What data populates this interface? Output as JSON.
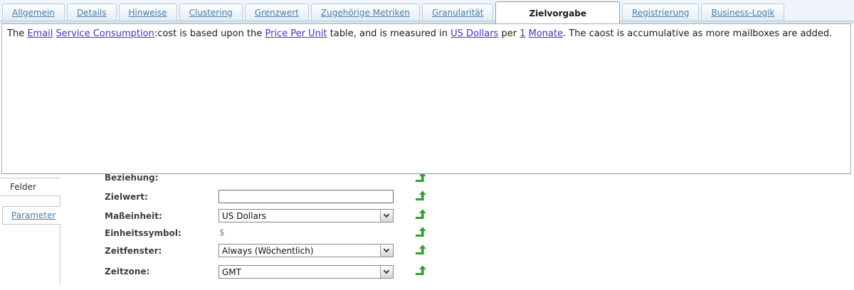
{
  "tabs": {
    "items": [
      {
        "label": "Allgemein",
        "active": false
      },
      {
        "label": "Details",
        "active": false
      },
      {
        "label": "Hinweise",
        "active": false
      },
      {
        "label": "Clustering",
        "active": false
      },
      {
        "label": "Grenzwert",
        "active": false
      },
      {
        "label": "Zugehörige Metriken",
        "active": false
      },
      {
        "label": "Granularität",
        "active": false
      },
      {
        "label": "Zielvorgabe",
        "active": true
      },
      {
        "label": "Registrierung",
        "active": false
      },
      {
        "label": "Business-Logik",
        "active": false
      }
    ]
  },
  "notes": {
    "segments": [
      {
        "text": "The ",
        "link": false
      },
      {
        "text": "Email",
        "link": true
      },
      {
        "text": " ",
        "link": false
      },
      {
        "text": "Service Consumption",
        "link": true
      },
      {
        "text": ":cost is based upon the ",
        "link": false
      },
      {
        "text": "Price Per Unit",
        "link": true
      },
      {
        "text": " table, and is measured in ",
        "link": false
      },
      {
        "text": "US Dollars",
        "link": true
      },
      {
        "text": " per ",
        "link": false
      },
      {
        "text": "1",
        "link": true
      },
      {
        "text": " ",
        "link": false
      },
      {
        "text": "Monate",
        "link": true
      },
      {
        "text": ". The caost is accumulative as more mailboxes are added.",
        "link": false
      }
    ]
  },
  "side_tabs": [
    {
      "label": "Felder",
      "active": true
    },
    {
      "label": "Parameter",
      "active": false
    }
  ],
  "form": {
    "rows": [
      {
        "id": "beziehung",
        "label": "Beziehung:",
        "type": "none",
        "value": ""
      },
      {
        "id": "zielwert",
        "label": "Zielwert:",
        "type": "text",
        "value": ""
      },
      {
        "id": "masseinheit",
        "label": "Maßeinheit:",
        "type": "select",
        "value": "US Dollars"
      },
      {
        "id": "einheitssymbol",
        "label": "Einheitssymbol:",
        "type": "static",
        "value": "$"
      },
      {
        "id": "zeitfenster",
        "label": "Zeitfenster:",
        "type": "select",
        "value": "Always (Wöchentlich)"
      },
      {
        "id": "zeitzone",
        "label": "Zeitzone:",
        "type": "select",
        "value": "GMT"
      }
    ]
  },
  "colors": {
    "apply_arrow_green": "#2EA12E",
    "note_link_blue": "#4433CC",
    "tab_link_blue": "#4A7FA5",
    "label_gray": "#3F3F3F"
  }
}
